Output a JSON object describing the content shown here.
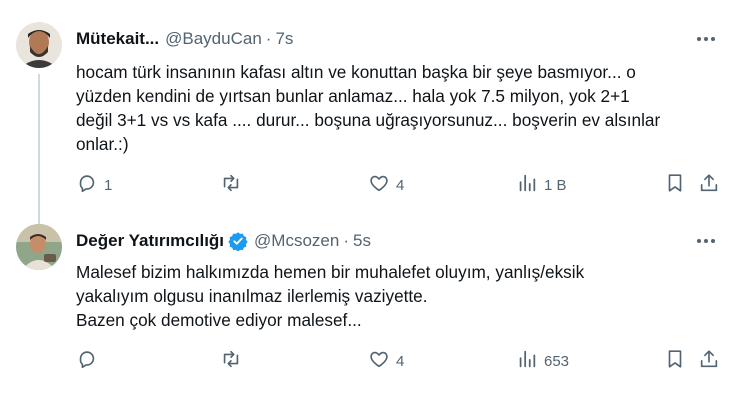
{
  "tweets": [
    {
      "name": "Mütekait...",
      "handle": "@BayduCan",
      "dot": "·",
      "time": "7s",
      "verified": false,
      "avatar_icon": "person-avatar",
      "lines": [
        "hocam türk insanının kafası altın ve konuttan başka bir şeye basmıyor... o",
        "yüzden kendini de yırtsan bunlar anlamaz... hala yok 7.5 milyon, yok 2+1",
        "değil 3+1 vs vs kafa .... durur... boşuna uğraşıyorsunuz... boşverin ev alsınlar",
        "onlar.:)"
      ],
      "stats": {
        "replies": "1",
        "retweets": "",
        "likes": "4",
        "views": "1 B"
      }
    },
    {
      "name": "Değer Yatırımcılığı",
      "handle": "@Mcsozen",
      "dot": "·",
      "time": "5s",
      "verified": true,
      "avatar_icon": "person-avatar",
      "lines": [
        "Malesef bizim halkımızda hemen bir muhalefet oluyım, yanlış/eksik",
        "yakalıyım olgusu inanılmaz ilerlemiş vaziyette.",
        "Bazen çok demotive ediyor malesef..."
      ],
      "stats": {
        "replies": "",
        "retweets": "",
        "likes": "4",
        "views": "653"
      }
    }
  ],
  "colors": {
    "text": "#0f1419",
    "muted": "#536471",
    "verified": "#1d9bf0",
    "thread_line": "#cfd9de"
  },
  "icons": [
    "reply-icon",
    "retweet-icon",
    "like-icon",
    "views-icon",
    "bookmark-icon",
    "share-icon",
    "more-icon",
    "verified-badge-icon"
  ]
}
